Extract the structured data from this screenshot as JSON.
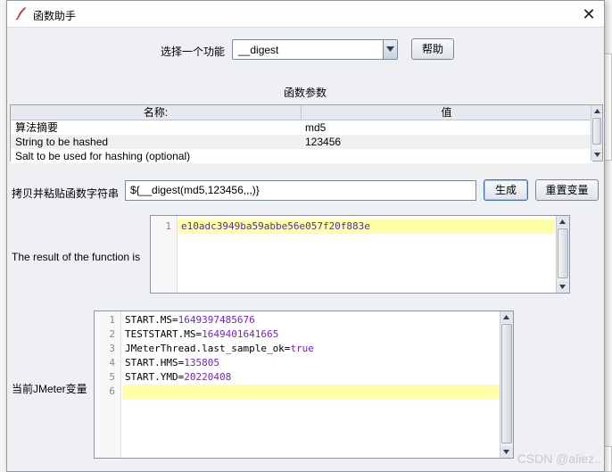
{
  "window": {
    "title": "函数助手",
    "close_glyph": "✕",
    "icon": "feather-icon"
  },
  "selector": {
    "label": "选择一个功能",
    "value": "__digest",
    "help_label": "帮助"
  },
  "params": {
    "heading": "函数参数",
    "columns": [
      "名称:",
      "值"
    ],
    "rows": [
      {
        "name": "算法摘要",
        "value": "md5"
      },
      {
        "name": "String to be hashed",
        "value": "123456"
      },
      {
        "name": "Salt to be used for hashing (optional)",
        "value": ""
      }
    ]
  },
  "function_string": {
    "label": "拷贝并粘贴函数字符串",
    "value": "${__digest(md5,123456,,,)}",
    "generate_label": "生成",
    "reset_label": "重置变量"
  },
  "result": {
    "label": "The result of the function is",
    "line_numbers": [
      "1"
    ],
    "lines": [
      "e10adc3949ba59abbe56e057f20f883e"
    ]
  },
  "variables": {
    "label": "当前JMeter变量",
    "line_numbers": [
      "1",
      "2",
      "3",
      "4",
      "5",
      "6"
    ],
    "lines": [
      {
        "key": "START.MS=",
        "val": "1649397485676"
      },
      {
        "key": "TESTSTART.MS=",
        "val": "1649401641665"
      },
      {
        "key": "JMeterThread.last_sample_ok=",
        "val": "true"
      },
      {
        "key": "START.HMS=",
        "val": "135805"
      },
      {
        "key": "START.YMD=",
        "val": "20220408"
      },
      {
        "key": "",
        "val": ""
      }
    ]
  },
  "watermark": "CSDN @aliez..",
  "colors": {
    "highlight_line": "#ffffaa",
    "variable_value": "#7a1fd6",
    "result_text": "#5a2ca0"
  }
}
